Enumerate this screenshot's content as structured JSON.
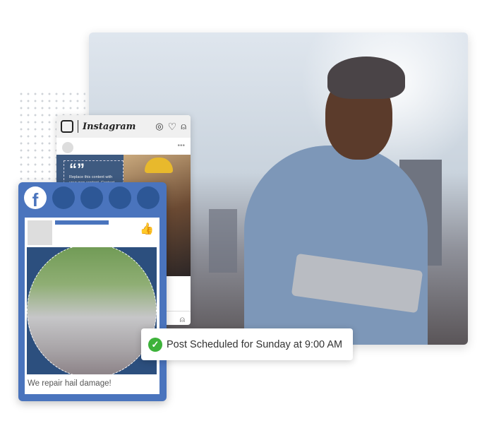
{
  "instagram": {
    "brand": "Instagram",
    "post_text": "Replace this content with your own content. Content",
    "quote_mark": "“”"
  },
  "facebook": {
    "caption": "We repair hail damage!",
    "brand_letter": "f"
  },
  "toast": {
    "message": "Post Scheduled for Sunday at 9:00 AM",
    "icon": "check-circle-icon"
  },
  "colors": {
    "facebook_blue": "#4a74bd",
    "success_green": "#3db23a"
  }
}
